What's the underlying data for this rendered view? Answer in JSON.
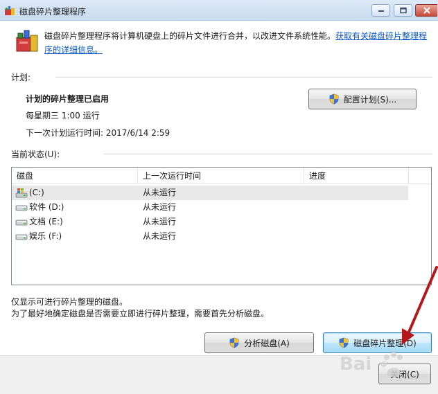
{
  "window": {
    "title": "磁盘碎片整理程序"
  },
  "intro": {
    "text": "磁盘碎片整理程序将计算机硬盘上的碎片文件进行合并，以改进文件系统性能。",
    "link": "获取有关磁盘碎片整理程序的详细信息。"
  },
  "schedule": {
    "label": "计划:",
    "heading": "计划的碎片整理已启用",
    "frequency": "每星期三  1:00 运行",
    "next_run": "下一次计划运行时间: 2017/6/14 2:59",
    "configure_button": "配置计划(S)..."
  },
  "status": {
    "label": "当前状态(U):",
    "columns": [
      "磁盘",
      "上一次运行时间",
      "进度"
    ],
    "rows": [
      {
        "disk": "(C:)",
        "last_run": "从未运行",
        "progress": "",
        "icon": "windows-drive-icon"
      },
      {
        "disk": "软件 (D:)",
        "last_run": "从未运行",
        "progress": "",
        "icon": "hard-drive-icon"
      },
      {
        "disk": "文档 (E:)",
        "last_run": "从未运行",
        "progress": "",
        "icon": "hard-drive-icon"
      },
      {
        "disk": "娱乐 (F:)",
        "last_run": "从未运行",
        "progress": "",
        "icon": "hard-drive-icon"
      }
    ]
  },
  "notes": {
    "line1": "仅显示可进行碎片整理的磁盘。",
    "line2": "为了最好地确定磁盘是否需要立即进行碎片整理，需要首先分析磁盘。"
  },
  "buttons": {
    "analyze": "分析磁盘(A)",
    "defrag": "磁盘碎片整理(D)",
    "close": "关闭(C)"
  },
  "colors": {
    "accent": "#0b58c5",
    "arrow": "#b4171a",
    "title_bg": "#dce9f7"
  }
}
